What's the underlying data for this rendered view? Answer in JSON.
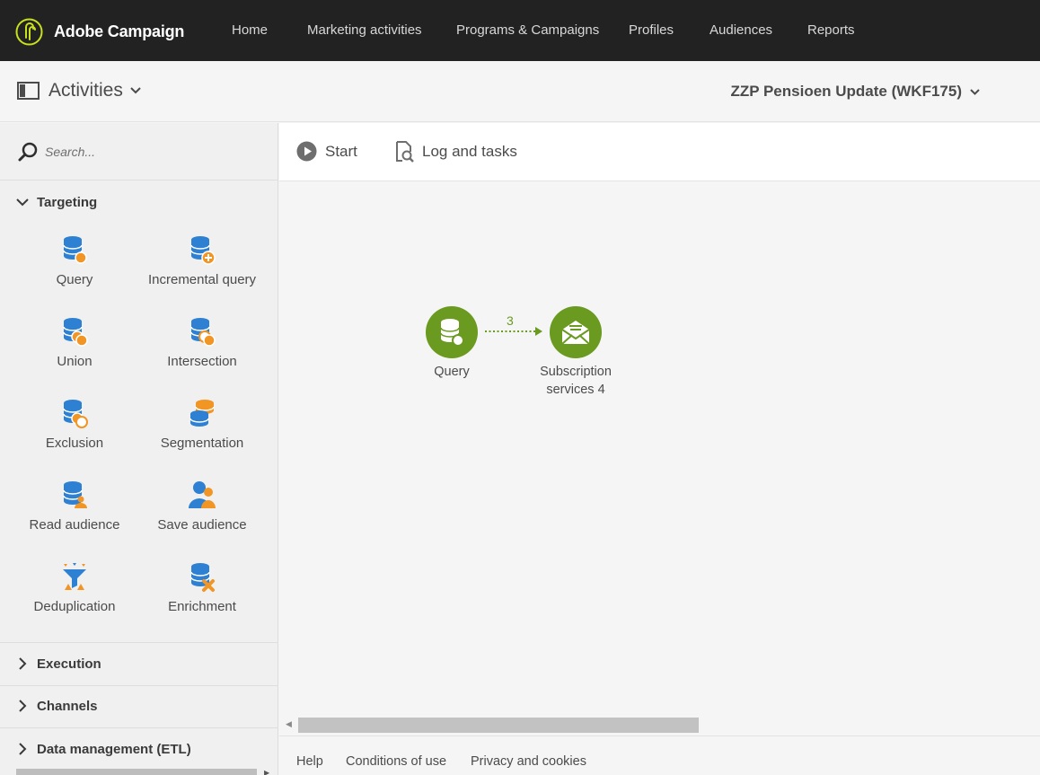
{
  "app": {
    "brand_name": "Adobe Campaign",
    "brand_color": "#c9e01f",
    "accent_green": "#6a9a1f"
  },
  "nav": {
    "items": [
      "Home",
      "Marketing activities",
      "Programs & Campaigns",
      "Profiles",
      "Audiences",
      "Reports"
    ]
  },
  "subheader": {
    "activities_label": "Activities",
    "workflow_title": "ZZP Pensioen Update (WKF175)"
  },
  "sidebar": {
    "search_placeholder": "Search...",
    "sections": [
      {
        "label": "Targeting",
        "expanded": true
      },
      {
        "label": "Execution",
        "expanded": false
      },
      {
        "label": "Channels",
        "expanded": false
      },
      {
        "label": "Data management (ETL)",
        "expanded": false
      }
    ],
    "targeting_activities": [
      {
        "label": "Query",
        "icon": "query-icon"
      },
      {
        "label": "Incremental query",
        "icon": "incremental-query-icon"
      },
      {
        "label": "Union",
        "icon": "union-icon"
      },
      {
        "label": "Intersection",
        "icon": "intersection-icon"
      },
      {
        "label": "Exclusion",
        "icon": "exclusion-icon"
      },
      {
        "label": "Segmentation",
        "icon": "segmentation-icon"
      },
      {
        "label": "Read audience",
        "icon": "read-audience-icon"
      },
      {
        "label": "Save audience",
        "icon": "save-audience-icon"
      },
      {
        "label": "Deduplication",
        "icon": "deduplication-icon"
      },
      {
        "label": "Enrichment",
        "icon": "enrichment-icon"
      }
    ]
  },
  "toolbar": {
    "start_label": "Start",
    "log_label": "Log and tasks"
  },
  "canvas": {
    "nodes": [
      {
        "label": "Query",
        "icon": "query-node-icon"
      },
      {
        "label": "Subscription services 4",
        "icon": "subscription-services-icon"
      }
    ],
    "transition": {
      "count": "3"
    }
  },
  "footer": {
    "links": [
      "Help",
      "Conditions of use",
      "Privacy and cookies"
    ]
  }
}
